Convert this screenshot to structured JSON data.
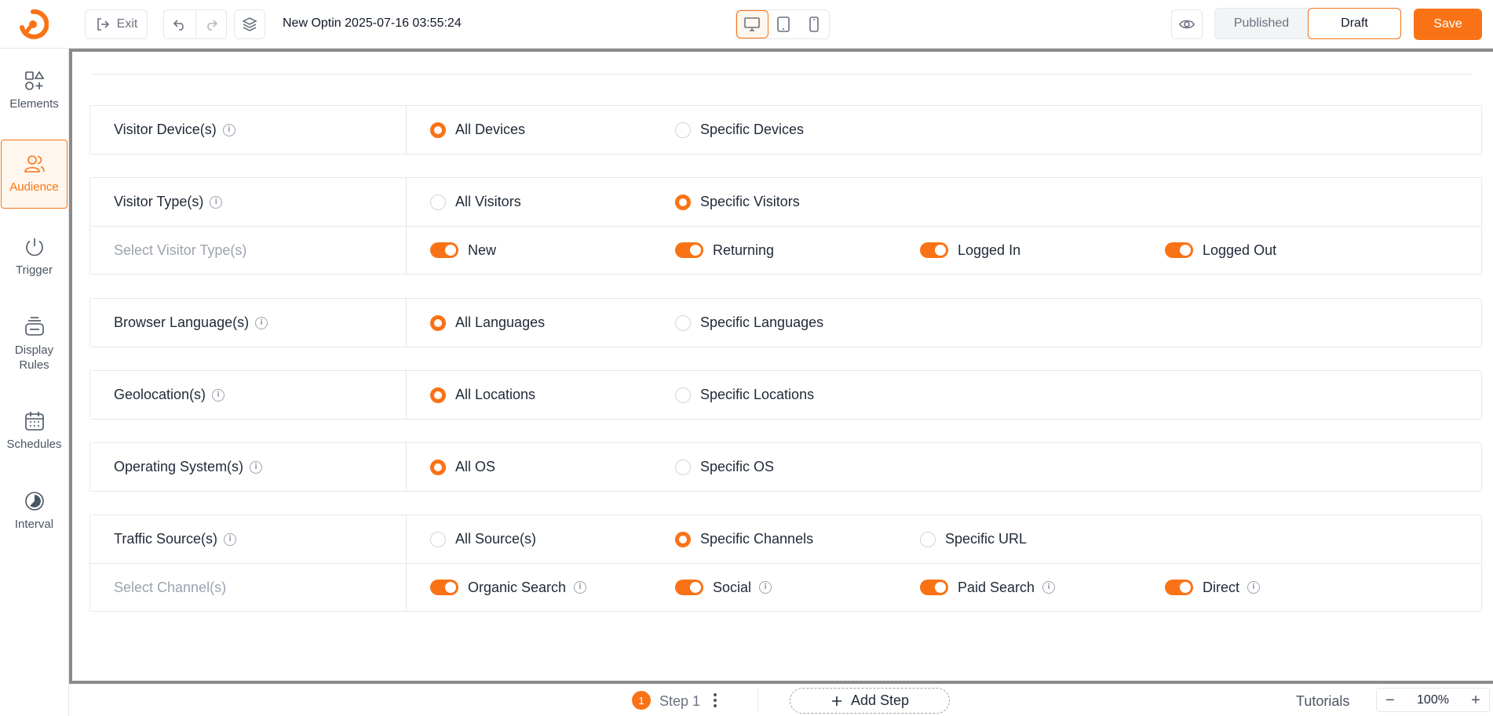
{
  "colors": {
    "accent": "#f97316",
    "border": "#e5e7eb",
    "muted": "#9ca3af"
  },
  "header": {
    "exit_label": "Exit",
    "title": "New Optin 2025-07-16 03:55:24",
    "devices": [
      "desktop-icon",
      "tablet-icon",
      "mobile-icon"
    ],
    "active_device": "desktop",
    "published_label": "Published",
    "draft_label": "Draft",
    "save_label": "Save"
  },
  "sidebar": {
    "items": [
      {
        "label": "Elements",
        "icon": "elements-icon"
      },
      {
        "label": "Audience",
        "icon": "audience-icon",
        "active": true
      },
      {
        "label": "Trigger",
        "icon": "power-icon"
      },
      {
        "label": "Display Rules",
        "icon": "display-rules-icon"
      },
      {
        "label": "Schedules",
        "icon": "calendar-icon"
      },
      {
        "label": "Interval",
        "icon": "interval-icon"
      }
    ]
  },
  "audience": {
    "device": {
      "label": "Visitor Device(s)",
      "options": [
        "All Devices",
        "Specific Devices"
      ],
      "selected": 0
    },
    "visitor_type": {
      "label": "Visitor Type(s)",
      "options": [
        "All Visitors",
        "Specific Visitors"
      ],
      "selected": 1,
      "sub_label": "Select Visitor Type(s)",
      "toggles": [
        {
          "label": "New",
          "on": true
        },
        {
          "label": "Returning",
          "on": true
        },
        {
          "label": "Logged In",
          "on": true
        },
        {
          "label": "Logged Out",
          "on": true
        }
      ]
    },
    "language": {
      "label": "Browser Language(s)",
      "options": [
        "All Languages",
        "Specific Languages"
      ],
      "selected": 0
    },
    "geolocation": {
      "label": "Geolocation(s)",
      "options": [
        "All Locations",
        "Specific Locations"
      ],
      "selected": 0
    },
    "os": {
      "label": "Operating System(s)",
      "options": [
        "All OS",
        "Specific OS"
      ],
      "selected": 0
    },
    "traffic": {
      "label": "Traffic Source(s)",
      "options": [
        "All Source(s)",
        "Specific Channels",
        "Specific URL"
      ],
      "selected": 1,
      "sub_label": "Select Channel(s)",
      "toggles": [
        {
          "label": "Organic Search",
          "on": true
        },
        {
          "label": "Social",
          "on": true
        },
        {
          "label": "Paid Search",
          "on": true
        },
        {
          "label": "Direct",
          "on": true
        }
      ]
    }
  },
  "footer": {
    "step_number": "1",
    "step_label": "Step 1",
    "add_step_label": "Add Step",
    "tutorials_label": "Tutorials",
    "zoom_level": "100%"
  }
}
